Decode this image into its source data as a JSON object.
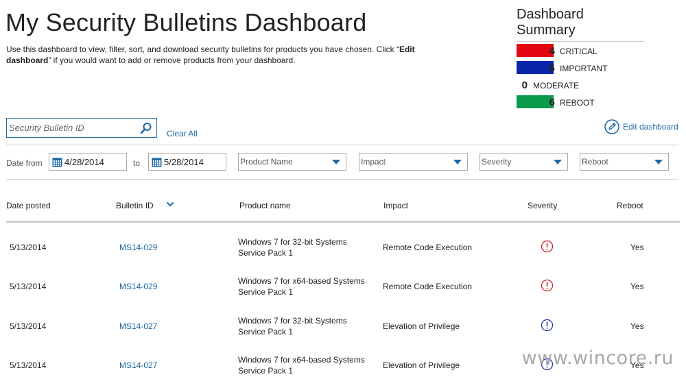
{
  "page": {
    "title": "My Security Bulletins Dashboard",
    "intro_text_1": "Use this dashboard to view, filter, sort, and download security bulletins for products you have chosen. Click “",
    "intro_bold_1": "Edit dashboard",
    "intro_text_2": "” if you would want to add or remove products from your dashboard."
  },
  "summary": {
    "title": "Dashboard Summary",
    "rows": [
      {
        "count": "4",
        "label": "CRITICAL",
        "color": "#e30613"
      },
      {
        "count": "6",
        "label": "IMPORTANT",
        "color": "#0a24a8"
      },
      {
        "count": "0",
        "label": "MODERATE",
        "color": ""
      },
      {
        "count": "6",
        "label": "REBOOT",
        "color": "#0a9a4a"
      }
    ]
  },
  "search": {
    "placeholder": "Security Bulletin ID",
    "icon": "search-icon",
    "clear_label": "Clear All"
  },
  "edit_dashboard": {
    "label": "Edit dashboard",
    "icon": "pencil-icon"
  },
  "filters": {
    "date_from_label": "Date from",
    "date_from": "4/28/2014",
    "to_label": "to",
    "date_to": "5/28/2014",
    "product_name": "Product Name",
    "impact": "Impact",
    "severity": "Severity",
    "reboot": "Reboot"
  },
  "table": {
    "headers": {
      "date_posted": "Date posted",
      "bulletin_id": "Bulletin ID",
      "product_name": "Product name",
      "impact": "Impact",
      "severity": "Severity",
      "reboot": "Reboot"
    },
    "rows": [
      {
        "date": "5/13/2014",
        "id": "MS14-029",
        "product_1": "Windows 7 for 32-bit Systems",
        "product_2": "Service Pack 1",
        "impact": "Remote Code Execution",
        "severity": "critical",
        "severity_color": "#d0161e",
        "reboot": "Yes"
      },
      {
        "date": "5/13/2014",
        "id": "MS14-029",
        "product_1": "Windows 7 for x64-based Systems",
        "product_2": "Service Pack 1",
        "impact": "Remote Code Execution",
        "severity": "critical",
        "severity_color": "#d0161e",
        "reboot": "Yes"
      },
      {
        "date": "5/13/2014",
        "id": "MS14-027",
        "product_1": "Windows 7 for 32-bit Systems",
        "product_2": "Service Pack 1",
        "impact": "Elevation of Privilege",
        "severity": "important",
        "severity_color": "#1a2fa8",
        "reboot": "Yes"
      },
      {
        "date": "5/13/2014",
        "id": "MS14-027",
        "product_1": "Windows 7 for x64-based Systems",
        "product_2": "Service Pack 1",
        "impact": "Elevation of Privilege",
        "severity": "important",
        "severity_color": "#1a2fa8",
        "reboot": "Yes"
      }
    ]
  },
  "watermark": "www.wincore.ru"
}
